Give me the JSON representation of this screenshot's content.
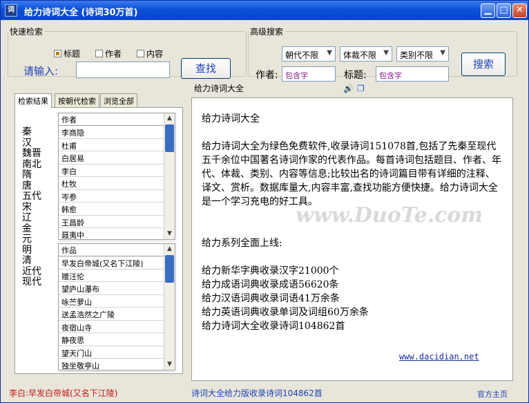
{
  "window": {
    "title": "给力诗词大全    (诗词30万首)",
    "icon": "app-icon",
    "min_symbol": "▁",
    "max_symbol": "□",
    "close_symbol": "✕"
  },
  "quick_search": {
    "legend": "快速检索",
    "options": [
      {
        "label": "标题",
        "checked": true
      },
      {
        "label": "作者",
        "checked": false
      },
      {
        "label": "内容",
        "checked": false
      }
    ],
    "prompt": "请输入:",
    "input_value": "",
    "button": "查找"
  },
  "advanced_search": {
    "legend": "高级搜索",
    "selects": [
      "朝代不限",
      "体裁不限",
      "类别不限"
    ],
    "author_label": "作者:",
    "author_value": "包含字",
    "title_label": "标题:",
    "title_value": "包含字",
    "button": "搜索"
  },
  "left_panel": {
    "tabs": [
      "检索结果",
      "按朝代检索",
      "浏览全部"
    ],
    "dynasties": [
      "秦",
      "汉",
      "魏晋",
      "南北",
      "隋",
      "唐",
      "五代",
      "宋",
      "辽",
      "金",
      "元",
      "明",
      "清",
      "近代",
      "现代"
    ],
    "authors_header": "作者",
    "authors": [
      "李商隐",
      "杜甫",
      "白居易",
      "李白",
      "杜牧",
      "岑参",
      "韩愈",
      "王昌龄",
      "聂夷中"
    ],
    "works_header": "作品",
    "works": [
      "早发白帝城(又名下江陵)",
      "赠汪伦",
      "望庐山瀑布",
      "咏苎萝山",
      "送孟浩然之广陵",
      "夜宿山寺",
      "静夜思",
      "望天门山",
      "独坐敬亭山"
    ]
  },
  "right_panel": {
    "title": "给力诗词大全",
    "speaker_icon": "speaker-icon",
    "copy_icon": "copy-icon",
    "content_heading": "给力诗词大全",
    "content_para": "给力诗词大全为绿色免费软件,收录诗词151078首,包括了先秦至现代五千余位中国著名诗词作家的代表作品。每首诗词包括题目、作者、年代、体裁、类别、内容等信息;比较出名的诗词篇目带有详细的注释、译文、赏析。数据库量大,内容丰富,查找功能方便快捷。给力诗词大全是一个学习充电的好工具。",
    "series_heading": "给力系列全面上线:",
    "series": [
      "给力新华字典收录汉字21000个",
      "给力成语词典收录成语56620条",
      "给力汉语词典收录词语41万余条",
      "给力英语词典收录单词及词组60万余条",
      "给力诗词大全收录诗词104862首"
    ],
    "link": "www.dacidian.net",
    "watermark": "www.DuoTe.com"
  },
  "status": {
    "left": "李白:早发白帝城(又名下江陵)",
    "middle": "诗词大全给力版收录诗词104862首",
    "right": "官方主页"
  }
}
